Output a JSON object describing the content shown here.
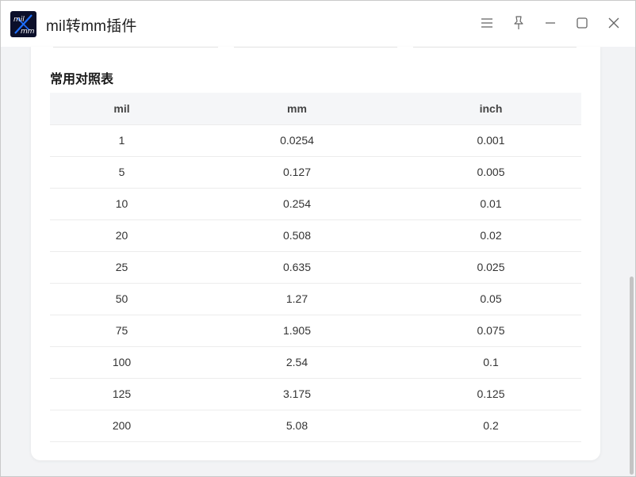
{
  "window": {
    "title": "mil转mm插件",
    "icon_text_top": "mil",
    "icon_text_bottom": "mm",
    "controls": [
      "menu-icon",
      "pin-icon",
      "minimize-icon",
      "maximize-icon",
      "close-icon"
    ]
  },
  "section": {
    "title": "常用对照表"
  },
  "table": {
    "headers": [
      "mil",
      "mm",
      "inch"
    ],
    "rows": [
      [
        "1",
        "0.0254",
        "0.001"
      ],
      [
        "5",
        "0.127",
        "0.005"
      ],
      [
        "10",
        "0.254",
        "0.01"
      ],
      [
        "20",
        "0.508",
        "0.02"
      ],
      [
        "25",
        "0.635",
        "0.025"
      ],
      [
        "50",
        "1.27",
        "0.05"
      ],
      [
        "75",
        "1.905",
        "0.075"
      ],
      [
        "100",
        "2.54",
        "0.1"
      ],
      [
        "125",
        "3.175",
        "0.125"
      ],
      [
        "200",
        "5.08",
        "0.2"
      ]
    ]
  },
  "colors": {
    "window_bg": "#f2f3f5",
    "card_bg": "#ffffff",
    "header_bg": "#f5f6f8",
    "icon_bg": "#0b0f2a",
    "icon_accent": "#1e6fff"
  }
}
